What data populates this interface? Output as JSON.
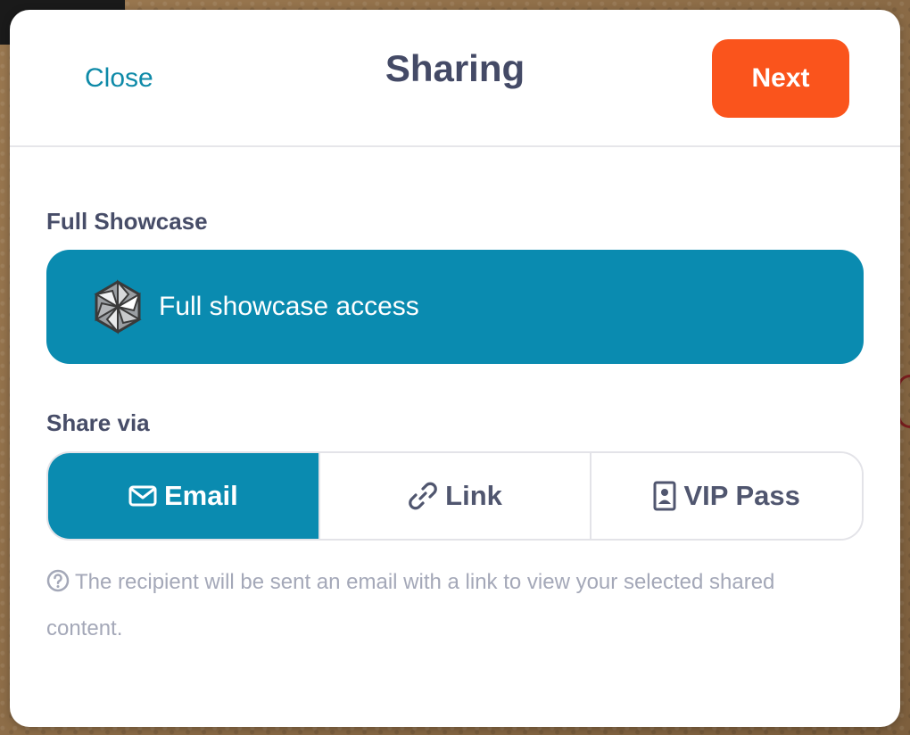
{
  "header": {
    "close_label": "Close",
    "title": "Sharing",
    "next_label": "Next"
  },
  "showcase": {
    "section_label": "Full Showcase",
    "option_label": "Full showcase access",
    "icon": "showcase-logo-icon"
  },
  "share_via": {
    "section_label": "Share via",
    "options": [
      {
        "label": "Email",
        "icon": "envelope-icon",
        "selected": true
      },
      {
        "label": "Link",
        "icon": "link-icon",
        "selected": false
      },
      {
        "label": "VIP Pass",
        "icon": "badge-icon",
        "selected": false
      }
    ]
  },
  "help_text": "The recipient will be sent an email with a link to view your selected shared content.",
  "colors": {
    "accent": "#0a8bb0",
    "next_button": "#fa541c",
    "title_text": "#444a66",
    "help_text": "#a4a8b8"
  }
}
